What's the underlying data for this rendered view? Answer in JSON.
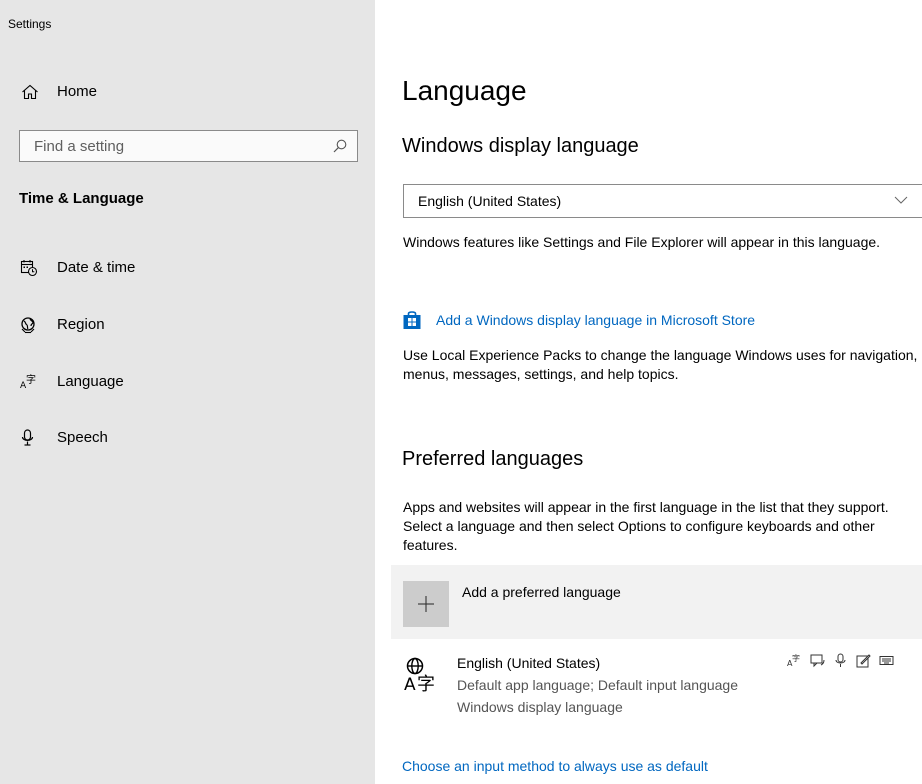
{
  "window": {
    "title": "Settings"
  },
  "sidebar": {
    "home_label": "Home",
    "search_placeholder": "Find a setting",
    "section_heading": "Time & Language",
    "items": [
      {
        "label": "Date & time",
        "icon": "calendar-clock-icon"
      },
      {
        "label": "Region",
        "icon": "globe-icon"
      },
      {
        "label": "Language",
        "icon": "language-icon"
      },
      {
        "label": "Speech",
        "icon": "microphone-icon"
      }
    ]
  },
  "main": {
    "title": "Language",
    "display_language": {
      "heading": "Windows display language",
      "selected": "English (United States)",
      "description": "Windows features like Settings and File Explorer will appear in this language.",
      "store_link": "Add a Windows display language in Microsoft Store",
      "experience_text": "Use Local Experience Packs to change the language Windows uses for navigation, menus, messages, settings, and help topics."
    },
    "preferred": {
      "heading": "Preferred languages",
      "description": "Apps and websites will appear in the first language in the list that they support. Select a language and then select Options to configure keyboards and other features.",
      "add_label": "Add a preferred language",
      "languages": [
        {
          "name": "English (United States)",
          "line1": "Default app language; Default input language",
          "line2": "Windows display language",
          "feature_icons": [
            "language-pack-icon",
            "text-to-speech-icon",
            "speech-recognition-icon",
            "handwriting-icon",
            "keyboard-icon"
          ]
        }
      ],
      "input_method_link": "Choose an input method to always use as default"
    }
  },
  "colors": {
    "sidebar_bg": "#e6e6e6",
    "accent": "#0067c0",
    "add_row_bg": "#f2f2f2"
  }
}
